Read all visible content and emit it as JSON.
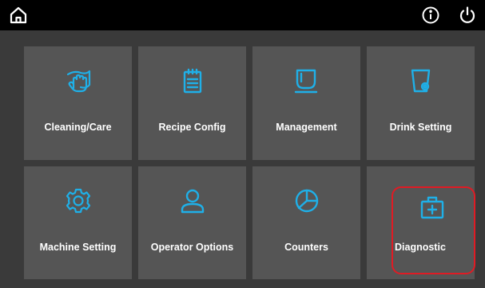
{
  "topbar": {
    "home_icon": "home-icon",
    "info_icon": "info-icon",
    "power_icon": "power-icon"
  },
  "tiles": [
    {
      "label": "Cleaning/Care",
      "icon": "hand-wash-icon"
    },
    {
      "label": "Recipe Config",
      "icon": "clipboard-icon"
    },
    {
      "label": "Management",
      "icon": "cup-icon"
    },
    {
      "label": "Drink Setting",
      "icon": "cup-settings-icon"
    },
    {
      "label": "Machine Setting",
      "icon": "gear-icon"
    },
    {
      "label": "Operator Options",
      "icon": "user-icon"
    },
    {
      "label": "Counters",
      "icon": "pie-chart-icon"
    },
    {
      "label": "Diagnostic",
      "icon": "first-aid-kit-icon"
    }
  ],
  "colors": {
    "accent": "#1fb0e8",
    "tile_bg": "#555555",
    "page_bg": "#3a3a3a",
    "topbar_bg": "#000000",
    "highlight": "#e01b24"
  }
}
